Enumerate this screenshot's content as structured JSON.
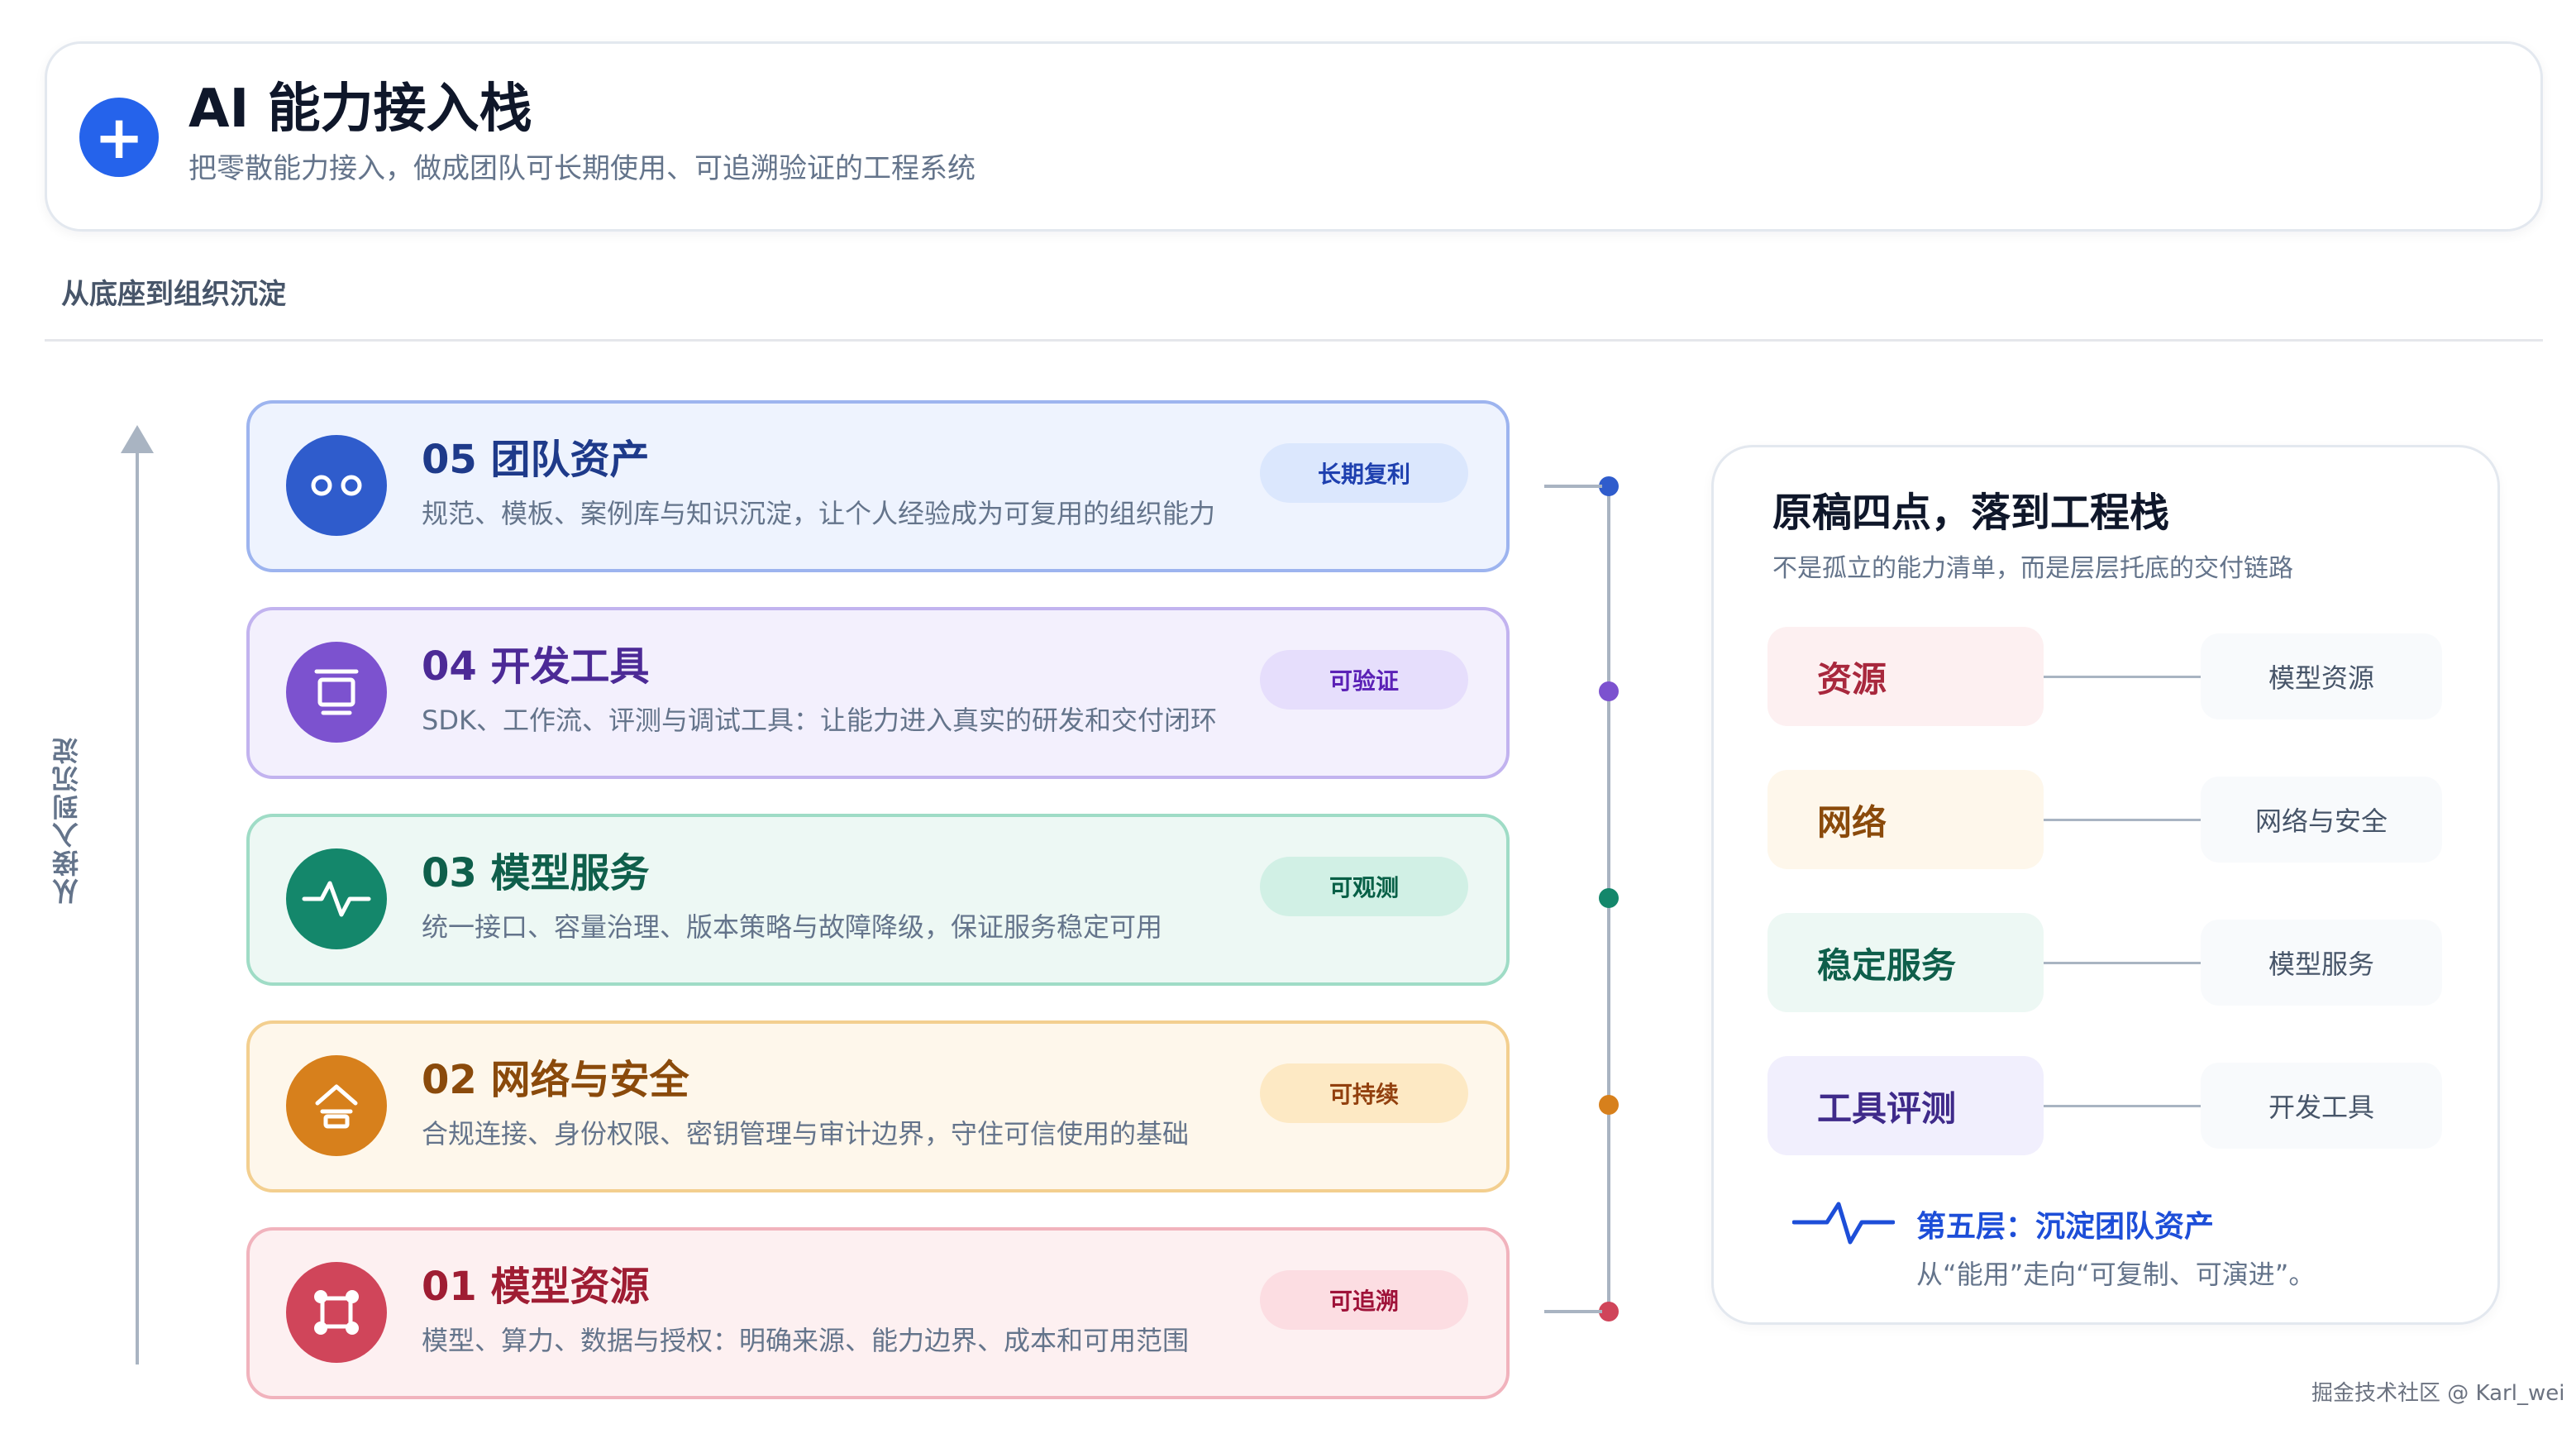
{
  "header": {
    "icon": "plus-icon",
    "title": "AI 能力接入栈",
    "subtitle": "把零散能力接入，做成团队可长期使用、可追溯验证的工程系统"
  },
  "section_label": "从底座到组织沉淀",
  "axis_label": "从接入到沉淀",
  "layers": [
    {
      "title": "05 团队资产",
      "desc": "规范、模板、案例库与知识沉淀，让个人经验成为可复用的组织能力",
      "badge": "长期复利",
      "icon": "two-dots-icon",
      "accent": "#2f5ccc",
      "bg": "#eef3fe",
      "border": "#9db4ef",
      "title_color": "#1e3a8a",
      "badge_bg": "#dbe7fd",
      "badge_color": "#1e40af"
    },
    {
      "title": "04 开发工具",
      "desc": "SDK、工作流、评测与调试工具：让能力进入真实的研发和交付闭环",
      "badge": "可验证",
      "icon": "monitor-icon",
      "accent": "#7c52cf",
      "bg": "#f3f0fd",
      "border": "#c2b3ef",
      "title_color": "#4c2a96",
      "badge_bg": "#e6defc",
      "badge_color": "#5b21b6"
    },
    {
      "title": "03 模型服务",
      "desc": "统一接口、容量治理、版本策略与故障降级，保证服务稳定可用",
      "badge": "可观测",
      "icon": "pulse-icon",
      "accent": "#14876b",
      "bg": "#edf8f4",
      "border": "#9fdcc6",
      "title_color": "#0f5f4b",
      "badge_bg": "#d1f0e5",
      "badge_color": "#065f46"
    },
    {
      "title": "02 网络与安全",
      "desc": "合规连接、身份权限、密钥管理与审计边界，守住可信使用的基础",
      "badge": "可持续",
      "icon": "shield-home-icon",
      "accent": "#d7801c",
      "bg": "#fef7eb",
      "border": "#f3cf8f",
      "title_color": "#8a4a0b",
      "badge_bg": "#fde9c4",
      "badge_color": "#92400e"
    },
    {
      "title": "01 模型资源",
      "desc": "模型、算力、数据与授权：明确来源、能力边界、成本和可用范围",
      "badge": "可追溯",
      "icon": "nodes-icon",
      "accent": "#d0455a",
      "bg": "#fdf0f1",
      "border": "#f1b3bd",
      "title_color": "#9f1d33",
      "badge_bg": "#fcdde2",
      "badge_color": "#9f1239"
    }
  ],
  "panel": {
    "title": "原稿四点，落到工程栈",
    "subtitle": "不是孤立的能力清单，而是层层托底的交付链路",
    "rows": [
      {
        "left": "资源",
        "right": "模型资源",
        "bg": "#fdf0f1",
        "color": "#a8283d"
      },
      {
        "left": "网络",
        "right": "网络与安全",
        "bg": "#fef7eb",
        "color": "#8a4a0b"
      },
      {
        "left": "稳定服务",
        "right": "模型服务",
        "bg": "#edf8f4",
        "color": "#0f5f4b"
      },
      {
        "left": "工具评测",
        "right": "开发工具",
        "bg": "#f1effd",
        "color": "#3f2a8a"
      }
    ],
    "fifth_title": "第五层：沉淀团队资产",
    "fifth_desc": "从“能用”走向“可复制、可演进”。",
    "fifth_icon": "pulse-icon"
  },
  "watermark": "掘金技术社区 @ Karl_wei"
}
